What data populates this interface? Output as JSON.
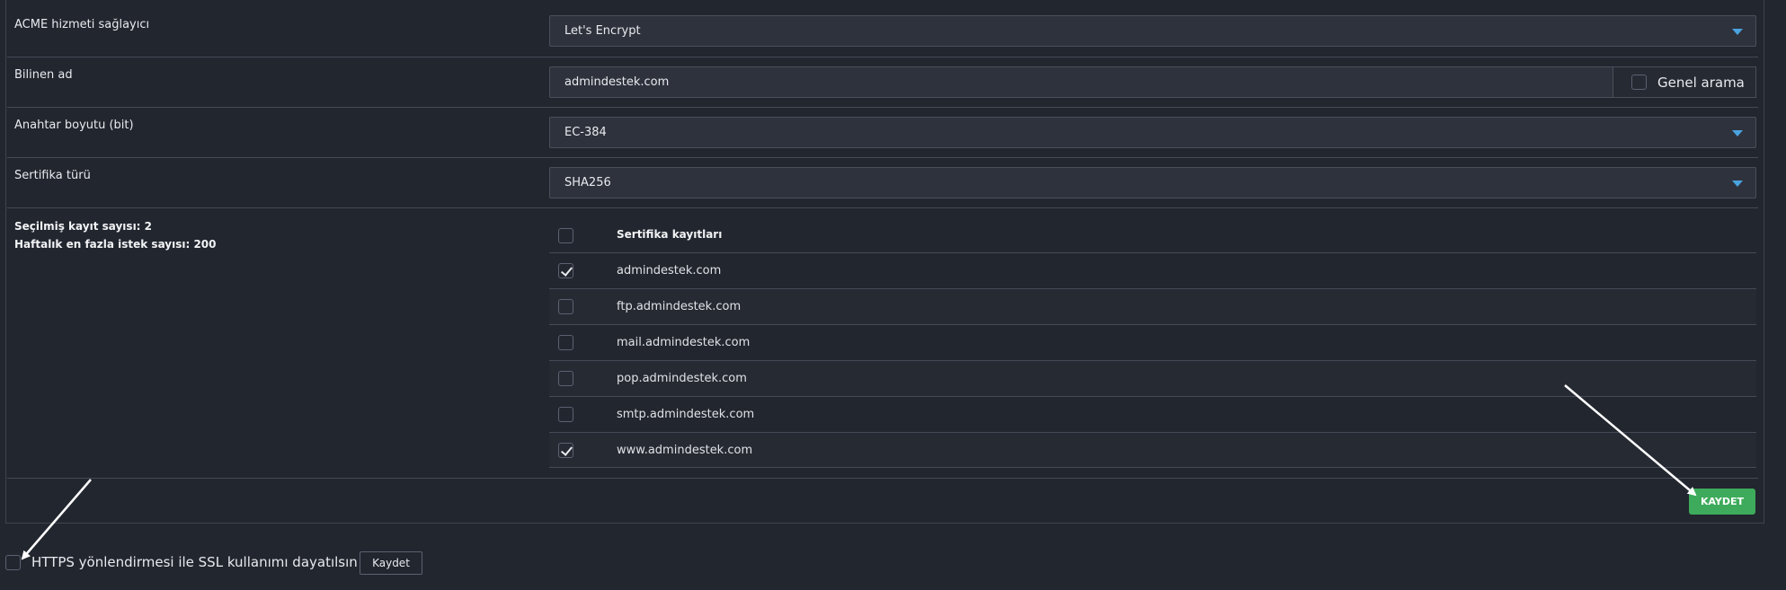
{
  "form": {
    "acme_label": "ACME hizmeti sağlayıcı",
    "acme_value": "Let's Encrypt",
    "common_name_label": "Bilinen ad",
    "common_name_value": "admindestek.com",
    "genel_arama_label": "Genel arama",
    "key_size_label": "Anahtar boyutu (bit)",
    "key_size_value": "EC-384",
    "cert_type_label": "Sertifika türü",
    "cert_type_value": "SHA256"
  },
  "stats": {
    "selected": "Seçilmiş kayıt sayısı: 2",
    "weekly_max": "Haftalık en fazla istek sayısı: 200"
  },
  "records": {
    "header": "Sertifika kayıtları",
    "header_checked": false,
    "items": [
      {
        "domain": "admindestek.com",
        "checked": true
      },
      {
        "domain": "ftp.admindestek.com",
        "checked": false
      },
      {
        "domain": "mail.admindestek.com",
        "checked": false
      },
      {
        "domain": "pop.admindestek.com",
        "checked": false
      },
      {
        "domain": "smtp.admindestek.com",
        "checked": false
      },
      {
        "domain": "www.admindestek.com",
        "checked": true
      }
    ]
  },
  "actions": {
    "save_label": "KAYDET",
    "https_label": "HTTPS yönlendirmesi ile SSL kullanımı dayatılsın",
    "https_checked": false,
    "save_small_label": "Kaydet"
  },
  "colors": {
    "background": "#22262f",
    "accent_caret": "#4aa3df",
    "save_button": "#3dab5b"
  },
  "icons": {
    "dropdown": "caret-down-icon",
    "checkbox_checked": "check-icon"
  }
}
